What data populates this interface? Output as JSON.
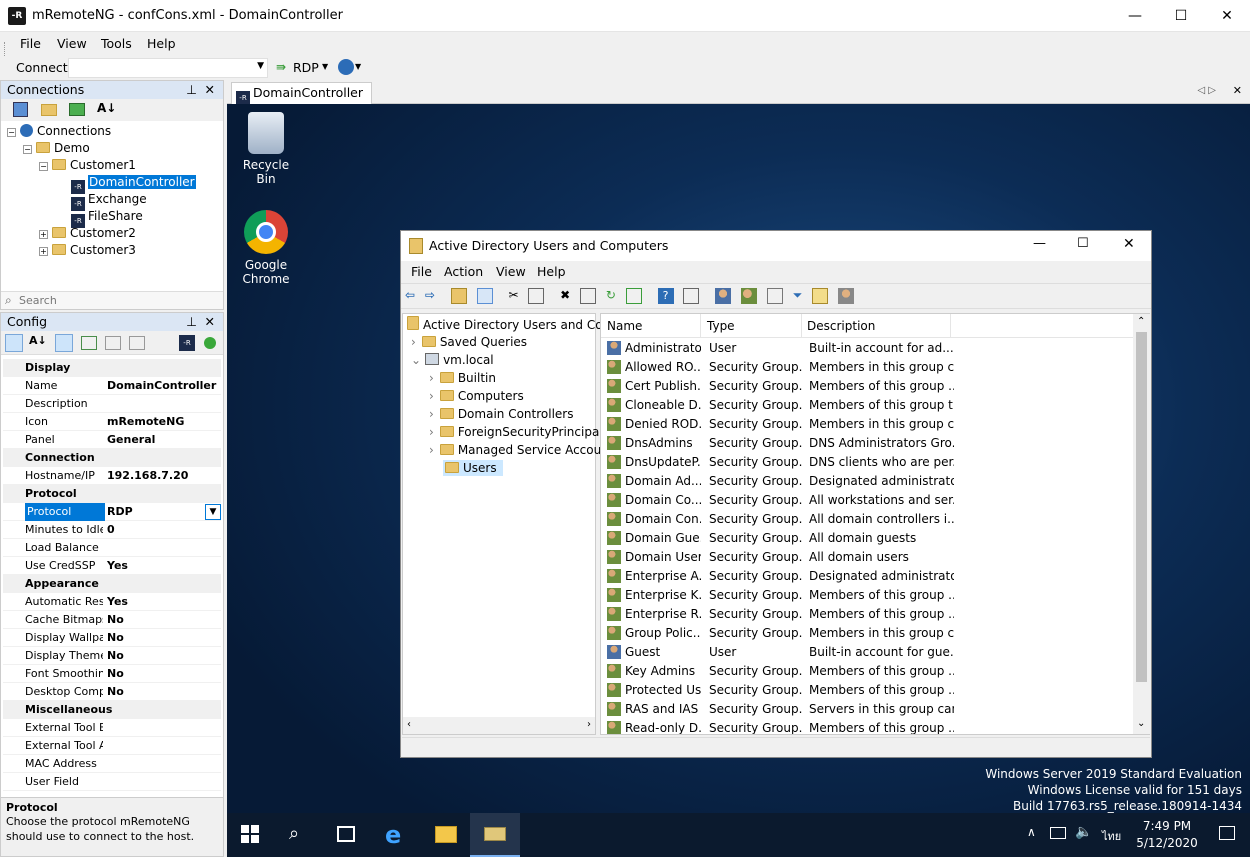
{
  "window": {
    "title": "mRemoteNG - confCons.xml - DomainController",
    "icon_text": "-R",
    "minimize_glyph": "—",
    "maximize_glyph": "☐",
    "close_glyph": "✕"
  },
  "menu": [
    "File",
    "View",
    "Tools",
    "Help"
  ],
  "connect_bar": {
    "label": "Connect:",
    "value": "",
    "protocol": "RDP"
  },
  "connections": {
    "title": "Connections",
    "search_placeholder": "Search",
    "tree": {
      "root": "Connections",
      "demo": "Demo",
      "customer1": "Customer1",
      "domain_controller": "DomainController",
      "exchange": "Exchange",
      "fileshare": "FileShare",
      "customer2": "Customer2",
      "customer3": "Customer3"
    }
  },
  "config": {
    "title": "Config",
    "categories": {
      "display": "Display",
      "connection": "Connection",
      "protocol": "Protocol",
      "appearance": "Appearance",
      "misc": "Miscellaneous"
    },
    "rows": {
      "name": {
        "k": "Name",
        "v": "DomainController"
      },
      "description": {
        "k": "Description",
        "v": ""
      },
      "icon": {
        "k": "Icon",
        "v": "mRemoteNG"
      },
      "panel": {
        "k": "Panel",
        "v": "General"
      },
      "hostname": {
        "k": "Hostname/IP",
        "v": "192.168.7.20"
      },
      "protocol": {
        "k": "Protocol",
        "v": "RDP"
      },
      "idle": {
        "k": "Minutes to Idle",
        "v": "0"
      },
      "loadbal": {
        "k": "Load Balance Ir",
        "v": ""
      },
      "credssp": {
        "k": "Use CredSSP",
        "v": "Yes"
      },
      "autoresize": {
        "k": "Automatic Resi",
        "v": "Yes"
      },
      "cachebmp": {
        "k": "Cache Bitmaps",
        "v": "No"
      },
      "wallpaper": {
        "k": "Display Wallpa",
        "v": "No"
      },
      "themes": {
        "k": "Display Theme",
        "v": "No"
      },
      "fontsmooth": {
        "k": "Font Smoothin",
        "v": "No"
      },
      "desktopcomp": {
        "k": "Desktop Comp",
        "v": "No"
      },
      "exttoolb": {
        "k": "External Tool B",
        "v": ""
      },
      "exttoola": {
        "k": "External Tool A",
        "v": ""
      },
      "mac": {
        "k": "MAC Address",
        "v": ""
      },
      "userfield": {
        "k": "User Field",
        "v": ""
      }
    },
    "help_title": "Protocol",
    "help_text": "Choose the protocol mRemoteNG should use to connect to the host."
  },
  "tab": {
    "label": "DomainController"
  },
  "desktop": {
    "recycle_bin": "Recycle Bin",
    "chrome": "Google Chrome",
    "watermark": [
      "Windows Server 2019 Standard Evaluation",
      "Windows License valid for 151 days",
      "Build 17763.rs5_release.180914-1434"
    ],
    "clock_time": "7:49 PM",
    "clock_date": "5/12/2020",
    "lang": "ไทย"
  },
  "ad_window": {
    "title": "Active Directory Users and Computers",
    "menu": [
      "File",
      "Action",
      "View",
      "Help"
    ],
    "tree": {
      "root": "Active Directory Users and Com",
      "saved": "Saved Queries",
      "domain": "vm.local",
      "builtin": "Builtin",
      "computers": "Computers",
      "dcs": "Domain Controllers",
      "fsp": "ForeignSecurityPrincipals",
      "msa": "Managed Service Accour",
      "users": "Users"
    },
    "columns": [
      "Name",
      "Type",
      "Description"
    ],
    "rows": [
      {
        "name": "Administrator",
        "type": "User",
        "desc": "Built-in account for ad...",
        "kind": "user"
      },
      {
        "name": "Allowed RO...",
        "type": "Security Group...",
        "desc": "Members in this group c...",
        "kind": "group"
      },
      {
        "name": "Cert Publish...",
        "type": "Security Group...",
        "desc": "Members of this group ...",
        "kind": "group"
      },
      {
        "name": "Cloneable D...",
        "type": "Security Group...",
        "desc": "Members of this group t...",
        "kind": "group"
      },
      {
        "name": "Denied ROD...",
        "type": "Security Group...",
        "desc": "Members in this group c...",
        "kind": "group"
      },
      {
        "name": "DnsAdmins",
        "type": "Security Group...",
        "desc": "DNS Administrators Gro...",
        "kind": "group"
      },
      {
        "name": "DnsUpdateP...",
        "type": "Security Group...",
        "desc": "DNS clients who are per...",
        "kind": "group"
      },
      {
        "name": "Domain Ad...",
        "type": "Security Group...",
        "desc": "Designated administrato...",
        "kind": "group"
      },
      {
        "name": "Domain Co...",
        "type": "Security Group...",
        "desc": "All workstations and ser...",
        "kind": "group"
      },
      {
        "name": "Domain Con...",
        "type": "Security Group...",
        "desc": "All domain controllers i...",
        "kind": "group"
      },
      {
        "name": "Domain Gue...",
        "type": "Security Group...",
        "desc": "All domain guests",
        "kind": "group"
      },
      {
        "name": "Domain Users",
        "type": "Security Group...",
        "desc": "All domain users",
        "kind": "group"
      },
      {
        "name": "Enterprise A...",
        "type": "Security Group...",
        "desc": "Designated administrato...",
        "kind": "group"
      },
      {
        "name": "Enterprise K...",
        "type": "Security Group...",
        "desc": "Members of this group ...",
        "kind": "group"
      },
      {
        "name": "Enterprise R...",
        "type": "Security Group...",
        "desc": "Members of this group ...",
        "kind": "group"
      },
      {
        "name": "Group Polic...",
        "type": "Security Group...",
        "desc": "Members in this group c...",
        "kind": "group"
      },
      {
        "name": "Guest",
        "type": "User",
        "desc": "Built-in account for gue...",
        "kind": "user"
      },
      {
        "name": "Key Admins",
        "type": "Security Group...",
        "desc": "Members of this group ...",
        "kind": "group"
      },
      {
        "name": "Protected Us...",
        "type": "Security Group...",
        "desc": "Members of this group ...",
        "kind": "group"
      },
      {
        "name": "RAS and IAS ...",
        "type": "Security Group...",
        "desc": "Servers in this group can...",
        "kind": "group"
      },
      {
        "name": "Read-only D...",
        "type": "Security Group...",
        "desc": "Members of this group ...",
        "kind": "group"
      }
    ]
  },
  "colors": {
    "selection": "#0078d7",
    "panel_header": "#dbe6f4",
    "desktop": "#0c2c55"
  }
}
